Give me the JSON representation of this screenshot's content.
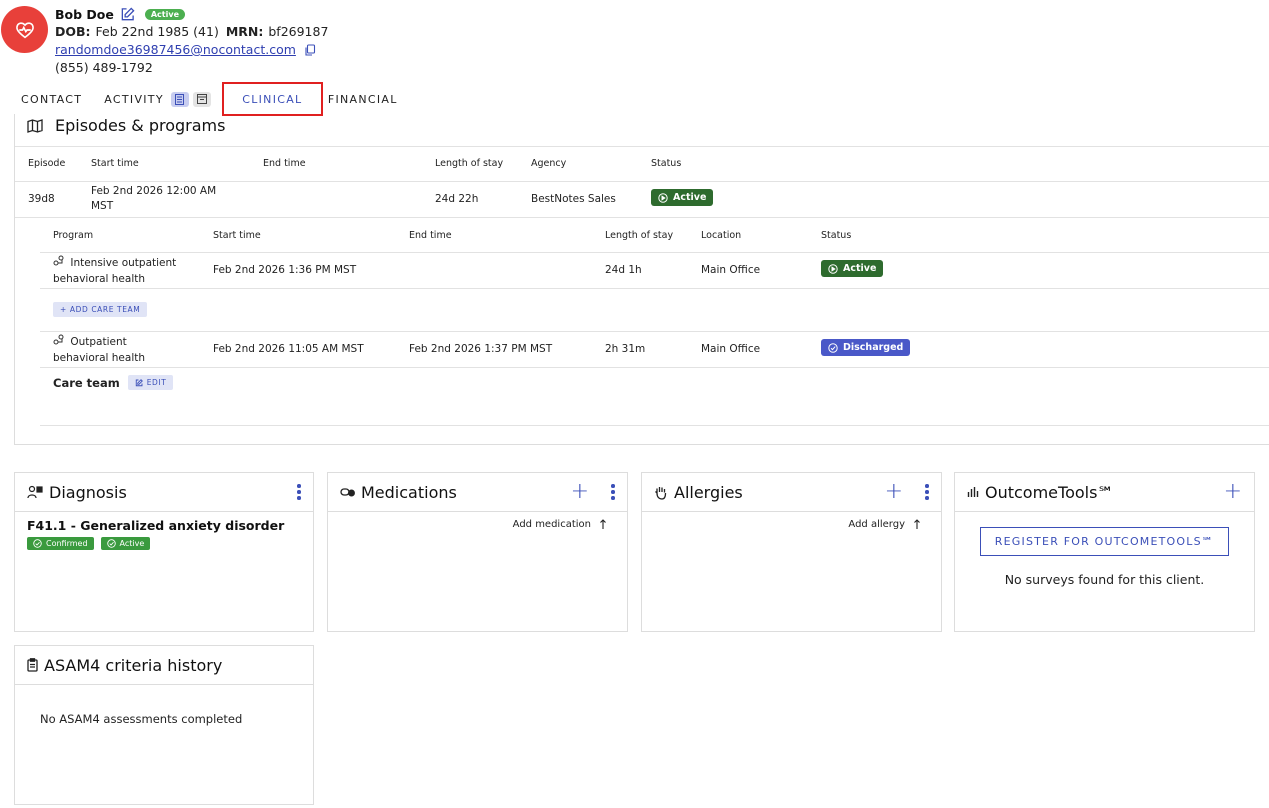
{
  "patient": {
    "name": "Bob Doe",
    "status": "Active",
    "dob_label": "DOB:",
    "dob": "Feb 22nd 1985 (41)",
    "mrn_label": "MRN:",
    "mrn": "bf269187",
    "email": "randomdoe36987456@nocontact.com",
    "phone": "(855) 489-1792"
  },
  "tabs": [
    {
      "label": "CONTACT"
    },
    {
      "label": "ACTIVITY"
    },
    {
      "label": "CLINICAL",
      "active": true
    },
    {
      "label": "FINANCIAL"
    }
  ],
  "episodes": {
    "title": "Episodes & programs",
    "headers": [
      "Episode",
      "Start time",
      "End time",
      "Length of stay",
      "Agency",
      "Status"
    ],
    "row": {
      "episode": "39d8",
      "start_line1": "Feb 2nd 2026 12:00 AM",
      "start_line2": "MST",
      "end": "",
      "los": "24d 22h",
      "agency": "BestNotes Sales",
      "status": "Active"
    },
    "program_headers": [
      "Program",
      "Start time",
      "End time",
      "Length of stay",
      "Location",
      "Status"
    ],
    "programs": [
      {
        "name_line1": "Intensive outpatient",
        "name_line2": "behavioral health",
        "start": "Feb 2nd 2026 1:36 PM MST",
        "end": "",
        "los": "24d 1h",
        "location": "Main Office",
        "status": "Active"
      },
      {
        "name_line1": "Outpatient",
        "name_line2": "behavioral health",
        "start": "Feb 2nd 2026 11:05 AM MST",
        "end": "Feb 2nd 2026 1:37 PM MST",
        "los": "2h 31m",
        "location": "Main Office",
        "status": "Discharged"
      }
    ],
    "add_care_team": "+ ADD CARE TEAM",
    "care_team_label": "Care team",
    "edit_label": "EDIT"
  },
  "diagnosis": {
    "title": "Diagnosis",
    "item": "F41.1 - Generalized anxiety disorder",
    "badges": [
      "Confirmed",
      "Active"
    ]
  },
  "medications": {
    "title": "Medications",
    "add_label": "Add medication"
  },
  "allergies": {
    "title": "Allergies",
    "add_label": "Add allergy"
  },
  "outcometools": {
    "title": "OutcomeTools℠",
    "register": "REGISTER FOR OUTCOMETOOLS℠",
    "empty": "No surveys found for this client."
  },
  "asam": {
    "title": "ASAM4 criteria history",
    "empty": "No ASAM4 assessments completed"
  },
  "colors": {
    "accent": "#3b4fb8",
    "danger": "#e8403a",
    "active_green": "#2e6b2e",
    "discharged_blue": "#4a58c8"
  }
}
